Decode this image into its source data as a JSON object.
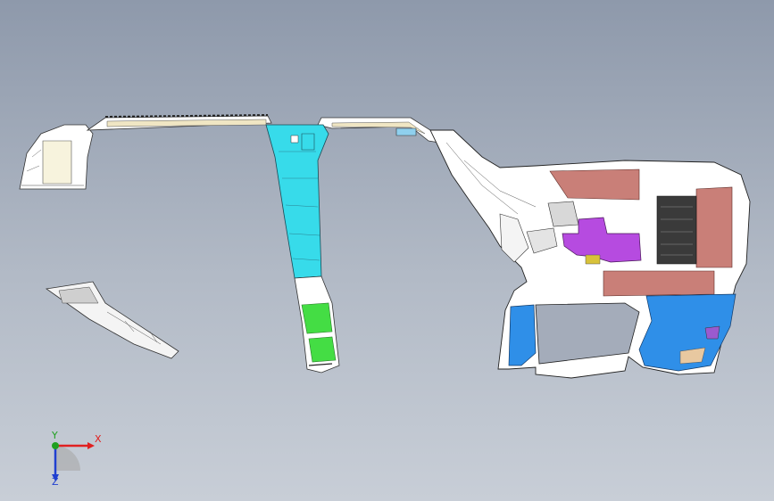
{
  "viewport": {
    "name": "cad-3d-graphics-area",
    "background_top": "#8e99ab",
    "background_bottom": "#c8ced7"
  },
  "parts": [
    {
      "name": "rear-left-quarter-trim",
      "color": "#f7f3dd"
    },
    {
      "name": "roof-side-rail-trim",
      "color": "#f0e6c4"
    },
    {
      "name": "b-pillar-upper-trim",
      "color": "#37dbea"
    },
    {
      "name": "b-pillar-lower-trim",
      "color": "#44dd44"
    },
    {
      "name": "front-door-opening-trim",
      "color": "#ffffff"
    },
    {
      "name": "salmon-panel",
      "color": "#c97f78"
    },
    {
      "name": "purple-bracket",
      "color": "#b64be0"
    },
    {
      "name": "blue-lower-trim",
      "color": "#2f8fe8"
    },
    {
      "name": "loose-pillar-fragment",
      "color": "#f4f4f4"
    }
  ],
  "triad": {
    "x_label": "X",
    "y_label": "Y",
    "z_label": "Z",
    "x_color": "#e02020",
    "y_color": "#20a020",
    "z_color": "#2040d0"
  }
}
